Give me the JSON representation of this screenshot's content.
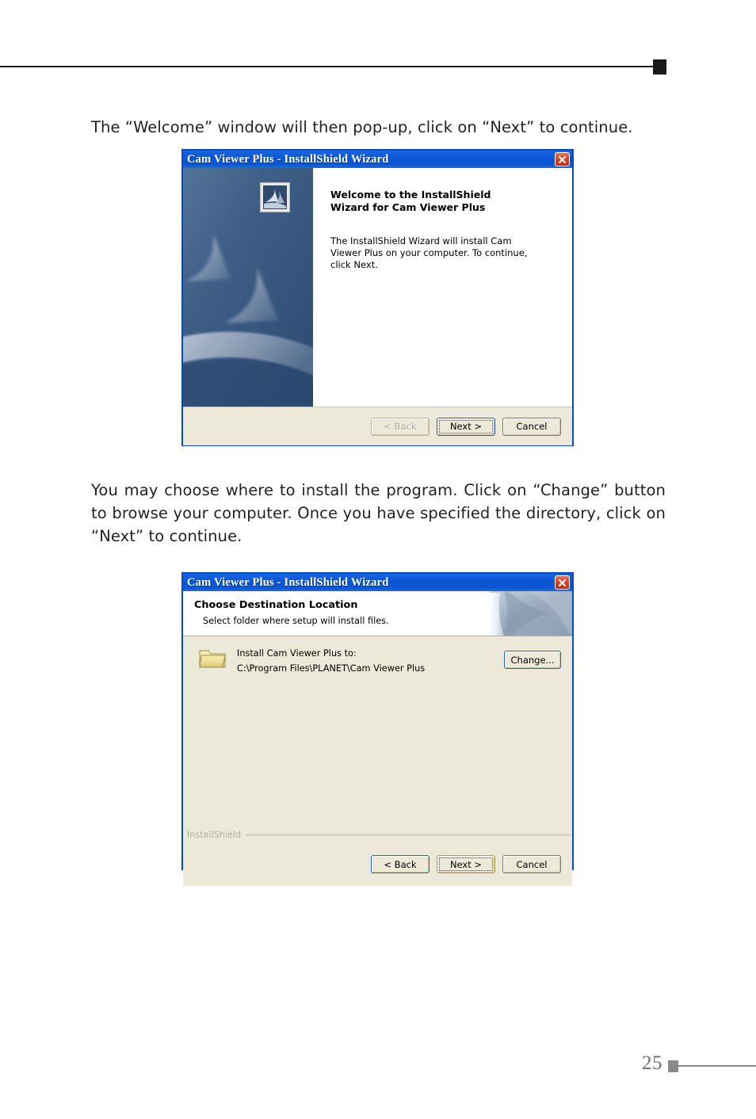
{
  "page": {
    "number": "25"
  },
  "paragraphs": {
    "first": "The “Welcome” window will then pop-up, click on “Next” to continue.",
    "second": "You may choose where to install the program. Click on “Change” button to browse your computer. Once you have specified the directory, click on “Next” to continue."
  },
  "welcome_dialog": {
    "title": "Cam Viewer Plus - InstallShield Wizard",
    "close_label": "✕",
    "heading": "Welcome to the InstallShield Wizard for Cam Viewer Plus",
    "description": "The InstallShield Wizard will install Cam Viewer Plus on your computer.  To continue, click Next.",
    "buttons": {
      "back": "< Back",
      "back_enabled": false,
      "next": "Next >",
      "cancel": "Cancel"
    }
  },
  "destination_dialog": {
    "title": "Cam Viewer Plus - InstallShield Wizard",
    "close_label": "✕",
    "banner_title": "Choose Destination Location",
    "banner_subtitle": "Select folder where setup will install files.",
    "install_label": "Install Cam Viewer Plus to:",
    "install_path": "C:\\Program Files\\PLANET\\Cam Viewer Plus",
    "change_button": "Change...",
    "installshield_label": "InstallShield",
    "buttons": {
      "back": "< Back",
      "next": "Next >",
      "cancel": "Cancel"
    }
  },
  "colors": {
    "titlebar_blue": "#0a56d6",
    "dialog_border": "#0a49c4",
    "dialog_face": "#ece9d8",
    "close_red": "#d4472a",
    "text_black": "#231f20",
    "footer_gray": "#8a8a8a"
  }
}
